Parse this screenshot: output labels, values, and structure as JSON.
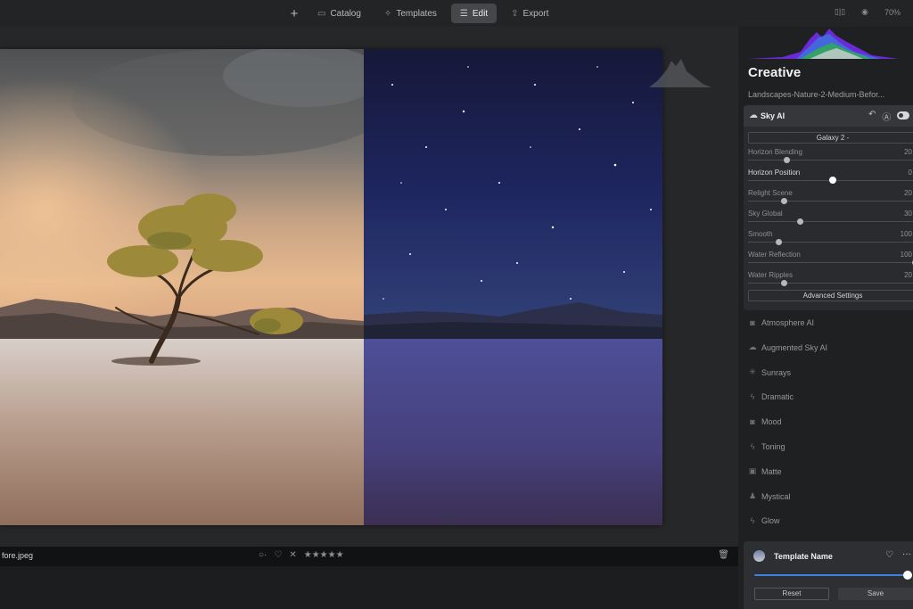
{
  "topbar": {
    "nav": [
      {
        "label": "Catalog",
        "icon": "folder-icon"
      },
      {
        "label": "Templates",
        "icon": "sparkle-icon"
      },
      {
        "label": "Edit",
        "icon": "sliders-icon",
        "active": true
      },
      {
        "label": "Export",
        "icon": "share-icon"
      }
    ],
    "zoom": "70%"
  },
  "panel": {
    "title": "Creative",
    "subtitle": "Landscapes-Nature-2-Medium-Befor...",
    "sky_ai": {
      "label": "Sky AI",
      "sky_preset": "Galaxy 2 -",
      "sliders": [
        {
          "name": "Horizon Blending",
          "value": "20",
          "level": 0.22
        },
        {
          "name": "Horizon Position",
          "value": "0",
          "level": 0.5,
          "highlighted": true
        },
        {
          "name": "Relight Scene",
          "value": "20",
          "level": 0.2
        },
        {
          "name": "Sky Global",
          "value": "30",
          "level": 0.3
        },
        {
          "name": "Smooth",
          "value": "100",
          "level": 0.17
        },
        {
          "name": "Water Reflection",
          "value": "100",
          "level": 1.0
        },
        {
          "name": "Water Ripples",
          "value": "20",
          "level": 0.2
        }
      ],
      "advanced_label": "Advanced Settings"
    },
    "tools": [
      {
        "label": "Atmosphere AI",
        "icon": "camera-icon"
      },
      {
        "label": "Augmented Sky AI",
        "icon": "cloud-icon"
      },
      {
        "label": "Sunrays",
        "icon": "sun-icon"
      },
      {
        "label": "Dramatic",
        "icon": "bolt-icon"
      },
      {
        "label": "Mood",
        "icon": "camera-icon"
      },
      {
        "label": "Toning",
        "icon": "bolt-icon"
      },
      {
        "label": "Matte",
        "icon": "square-icon"
      },
      {
        "label": "Mystical",
        "icon": "figure-icon"
      },
      {
        "label": "Glow",
        "icon": "bolt-icon"
      }
    ],
    "template": {
      "name": "Template Name",
      "amount": 1.0,
      "reset_label": "Reset",
      "save_label": "Save"
    }
  },
  "status": {
    "filename": "fore.jpeg",
    "rating_stars": 5
  }
}
